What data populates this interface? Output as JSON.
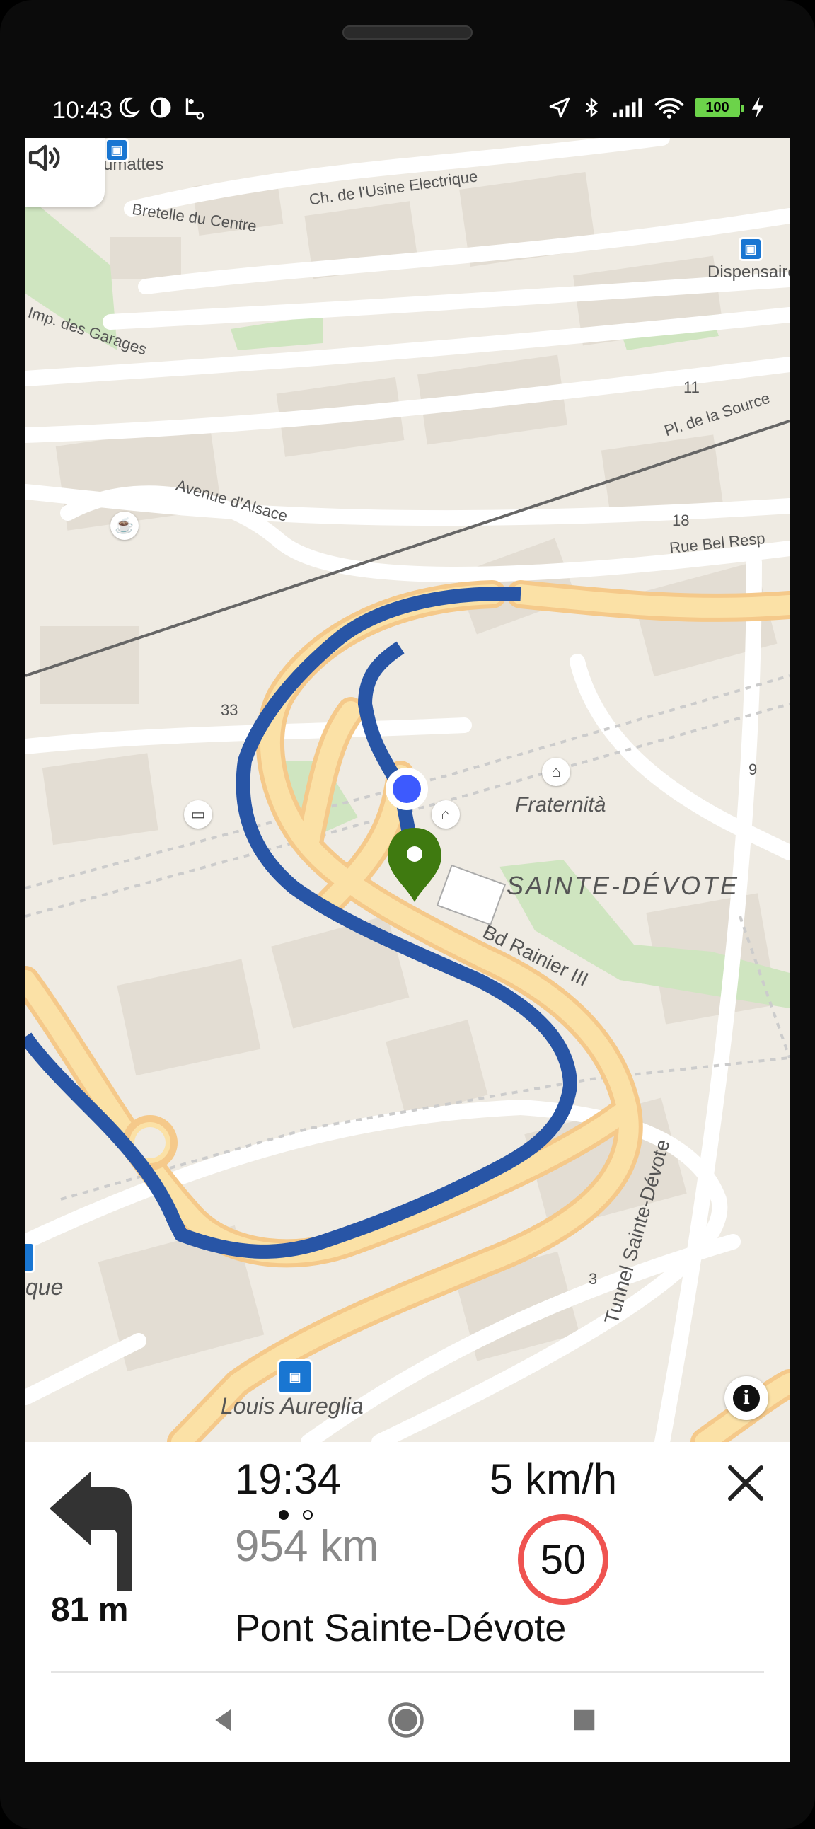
{
  "status_bar": {
    "time": "10:43",
    "left_icons": [
      "moon-icon",
      "data-saver-icon",
      "location-pin-icon"
    ],
    "right_icons": [
      "navigation-arrow-icon",
      "bluetooth-icon",
      "signal-icon",
      "wifi-icon",
      "battery-icon",
      "charging-icon"
    ],
    "battery_level": "100"
  },
  "map": {
    "labels": {
      "usinage": "umattes",
      "usine": "Ch. de l'Usine Electrique",
      "centre": "Bretelle du Centre",
      "dispensaire": "Dispensaire",
      "garages": "Imp. des Garages",
      "source": "Pl. de la Source",
      "alsace": "Avenue d'Alsace",
      "belresp": "Rue Bel Resp",
      "fraternita": "Fraternità",
      "devote": "SAINTE-DÉVOTE",
      "rainier": "Bd Rainier III",
      "tunnel": "Tunnel Sainte-Dévote",
      "aureglia": "Louis Aureglia",
      "que": "que",
      "n11": "11",
      "n18": "18",
      "n33": "33",
      "n9": "9",
      "n3": "3"
    },
    "route_color": "#2855a6",
    "current_location_color": "#3d5afe",
    "destination_color": "#3f7a10"
  },
  "navigation": {
    "turn_direction": "turn-left",
    "turn_distance": "81 m",
    "eta": "19:34",
    "remaining_distance": "954 km",
    "speed": "5 km/h",
    "speed_limit": "50",
    "street_name": "Pont Sainte-Dévote",
    "page_dots": [
      true,
      false
    ]
  },
  "system_nav": {
    "buttons": [
      "back-icon",
      "home-icon",
      "recents-icon"
    ]
  }
}
